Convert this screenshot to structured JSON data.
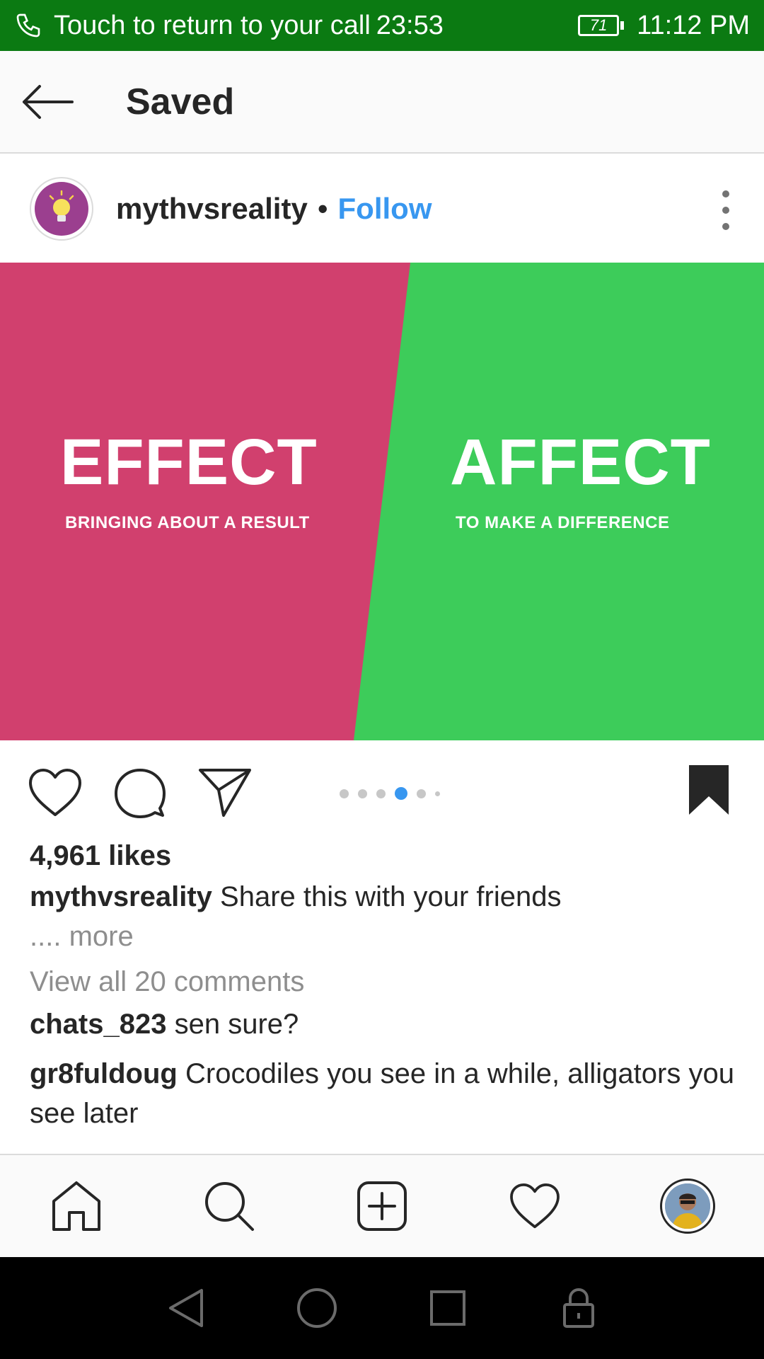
{
  "status_bar": {
    "call_text": "Touch to return to your call",
    "call_timer": "23:53",
    "battery": "71",
    "time": "11:12 PM"
  },
  "header": {
    "title": "Saved"
  },
  "post": {
    "username": "mythvsreality",
    "separator": "•",
    "follow_label": "Follow",
    "image": {
      "left_word": "EFFECT",
      "left_sub": "BRINGING ABOUT A RESULT",
      "right_word": "AFFECT",
      "right_sub": "TO MAKE A DIFFERENCE",
      "left_color": "#d1406e",
      "right_color": "#3dcc5a"
    },
    "carousel": {
      "total": 6,
      "active_index": 3,
      "active_color": "#3897f0"
    },
    "likes": "4,961 likes",
    "caption_user": "mythvsreality",
    "caption_text": "Share this with your friends",
    "more_label": ".... more",
    "view_all_comments": "View all 20 comments",
    "comments": [
      {
        "user": "chats_823",
        "text": "sen sure?"
      },
      {
        "user": "gr8fuldoug",
        "text": "Crocodiles you see in a while, alligators you see later"
      }
    ]
  },
  "bottom_nav": {
    "items": [
      "home-icon",
      "search-icon",
      "add-post-icon",
      "activity-heart-icon",
      "profile-avatar"
    ]
  },
  "colors": {
    "status_bar": "#0b7a12",
    "link_blue": "#3897f0",
    "text_primary": "#262626",
    "text_secondary": "#8e8e8e"
  }
}
